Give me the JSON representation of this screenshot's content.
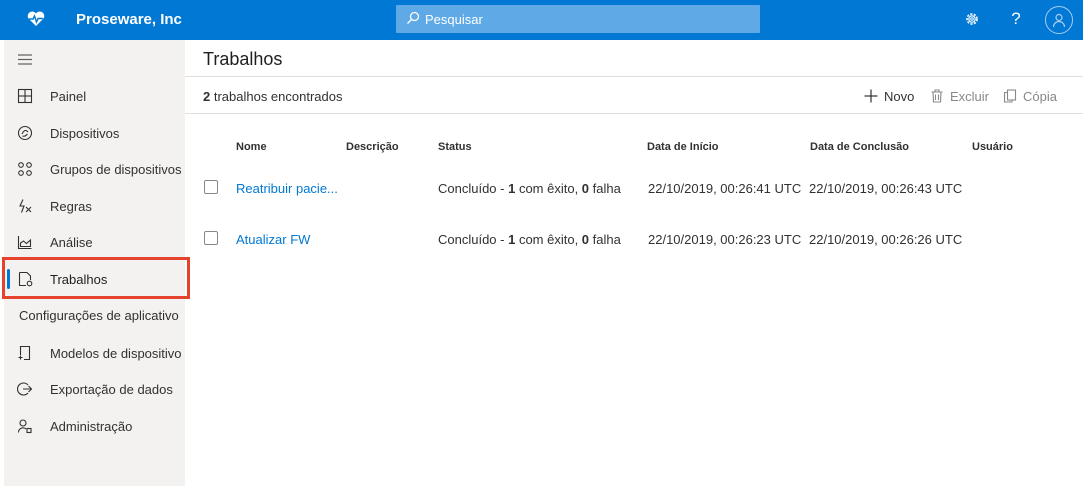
{
  "app": {
    "brand_name": "Proseware, Inc",
    "brand_icon": "heart-pulse-icon",
    "search_placeholder": "Pesquisar",
    "colors": {
      "header": "#0078d4",
      "accent": "#0078d4",
      "highlight": "#e6432f",
      "sidebar": "#f3f2f1"
    }
  },
  "sidebar": {
    "items": [
      {
        "label": "Painel",
        "icon": "dashboard-icon"
      },
      {
        "label": "Dispositivos",
        "icon": "devices-icon"
      },
      {
        "label": "Grupos de dispositivos",
        "icon": "device-groups-icon"
      },
      {
        "label": "Regras",
        "icon": "rules-icon"
      },
      {
        "label": "Análise",
        "icon": "analytics-icon"
      },
      {
        "label": "Trabalhos",
        "icon": "jobs-icon",
        "active": true
      }
    ],
    "section_header": "Configurações de aplicativo",
    "app_items": [
      {
        "label": "Modelos de dispositivo",
        "icon": "device-templates-icon"
      },
      {
        "label": "Exportação de dados",
        "icon": "data-export-icon"
      },
      {
        "label": "Administração",
        "icon": "administration-icon"
      }
    ]
  },
  "main": {
    "title": "Trabalhos",
    "count_number": "2",
    "count_suffix": " trabalhos encontrados",
    "commands": {
      "new": "Novo",
      "delete": "Excluir",
      "copy": "Cópia"
    },
    "columns": [
      "Nome",
      "Descrição",
      "Status",
      "Data de Início",
      "Data de Conclusão",
      "Usuário"
    ],
    "rows": [
      {
        "name": "Reatribuir pacie...",
        "description": "",
        "status_prefix": "Concluído - ",
        "success_count": "1",
        "success_label": " com êxito, ",
        "fail_count": "0",
        "fail_label": " falha",
        "start": "22/10/2019, 00:26:41 UTC",
        "end": "22/10/2019, 00:26:43 UTC",
        "user": ""
      },
      {
        "name": "Atualizar FW",
        "description": "",
        "status_prefix": "Concluído - ",
        "success_count": "1",
        "success_label": " com êxito, ",
        "fail_count": "0",
        "fail_label": " falha",
        "start": "22/10/2019, 00:26:23 UTC",
        "end": "22/10/2019, 00:26:26 UTC",
        "user": ""
      }
    ]
  }
}
